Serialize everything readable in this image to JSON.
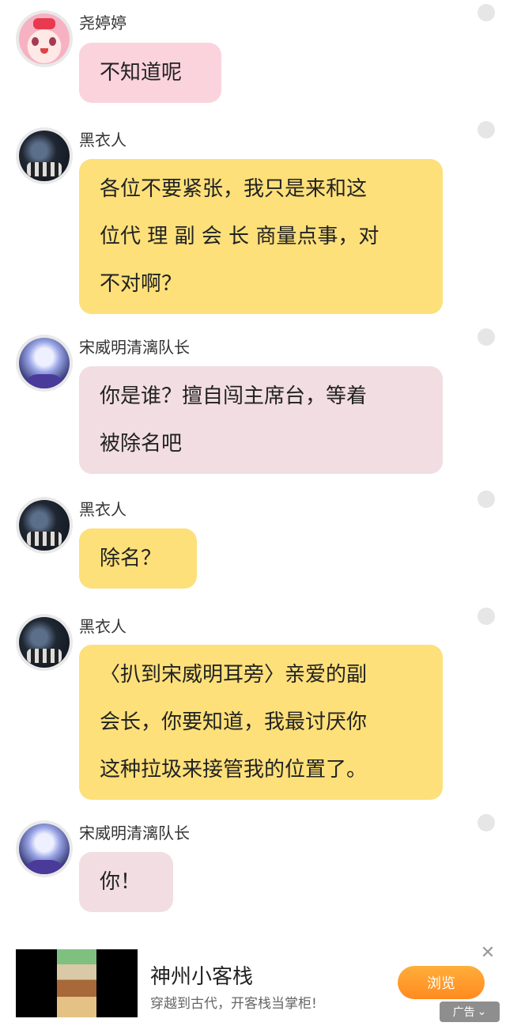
{
  "messages": [
    {
      "name": "尧婷婷",
      "text": "不知道呢",
      "avatar_icon": "girl-avatar-icon",
      "bubble_color": "#fbd3dd"
    },
    {
      "name": "黑衣人",
      "text": "各位不要紧张，我只是来和这\n位代 理 副 会 长 商量点事，对\n不对啊？",
      "avatar_icon": "dark-character-avatar-icon",
      "bubble_color": "#fde07a"
    },
    {
      "name": "宋威明清漓队长",
      "text": "你是谁？擅自闯主席台，等着\n被除名吧",
      "avatar_icon": "purple-hair-avatar-icon",
      "bubble_color": "#f1dde2"
    },
    {
      "name": "黑衣人",
      "text": "除名？",
      "avatar_icon": "dark-character-avatar-icon",
      "bubble_color": "#fde07a"
    },
    {
      "name": "黑衣人",
      "text": "〈扒到宋威明耳旁〉亲爱的副\n会长，你要知道，我最讨厌你\n这种拉圾来接管我的位置了。",
      "avatar_icon": "dark-character-avatar-icon",
      "bubble_color": "#fde07a"
    },
    {
      "name": "宋威明清漓队长",
      "text": "你！",
      "avatar_icon": "purple-hair-avatar-icon",
      "bubble_color": "#f1dde2"
    }
  ],
  "ad": {
    "title": "神州小客栈",
    "subtitle": "穿越到古代，开客栈当掌柜!",
    "button_label": "浏览",
    "badge_label": "广告",
    "close_icon": "close-icon"
  }
}
